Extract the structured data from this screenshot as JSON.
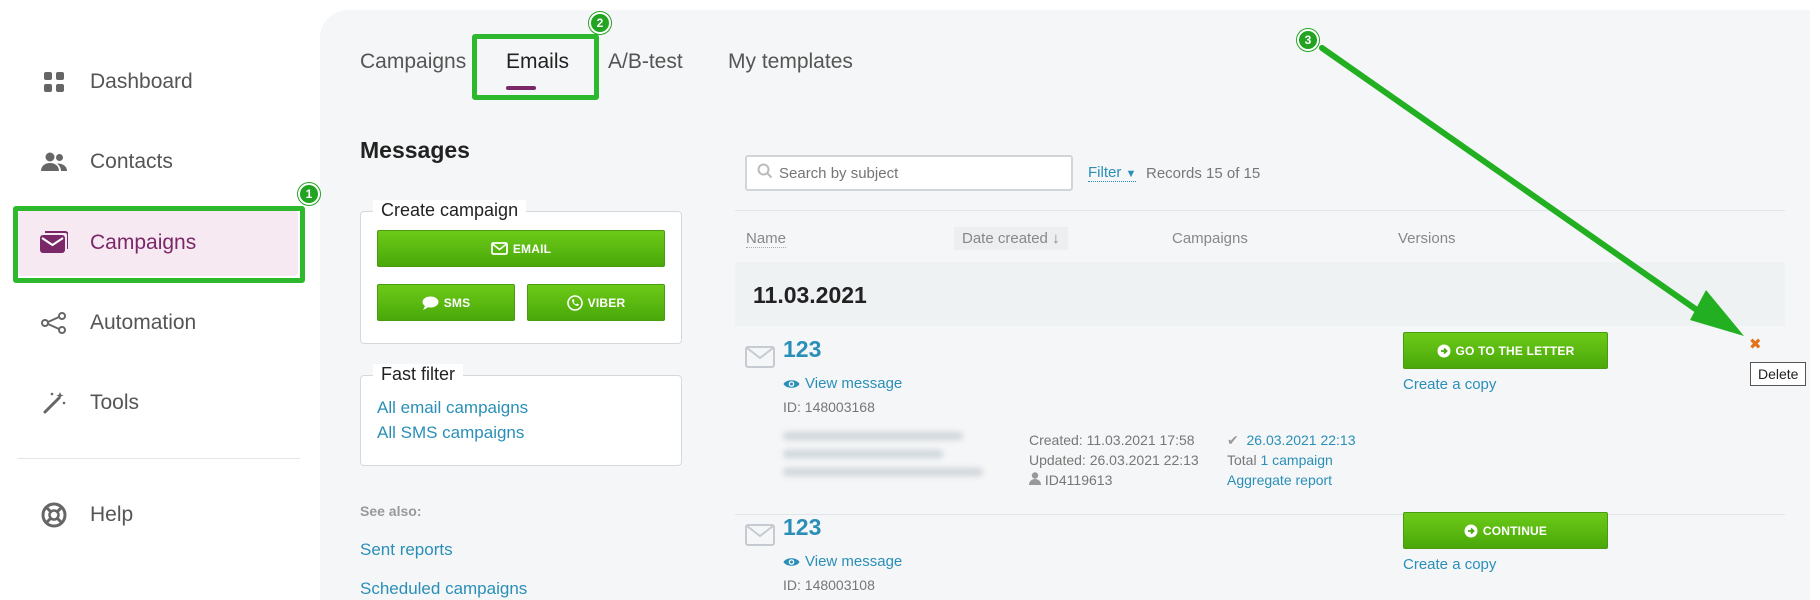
{
  "sidebar": {
    "items": [
      {
        "label": "Dashboard",
        "icon": "grid-icon"
      },
      {
        "label": "Contacts",
        "icon": "users-icon"
      },
      {
        "label": "Campaigns",
        "icon": "envelope-stack-icon"
      },
      {
        "label": "Automation",
        "icon": "share-nodes-icon"
      },
      {
        "label": "Tools",
        "icon": "magic-wand-icon"
      },
      {
        "label": "Help",
        "icon": "lifebuoy-icon"
      }
    ]
  },
  "annotations": {
    "badge_1": "1",
    "badge_2": "2",
    "badge_3": "3"
  },
  "tabs": [
    {
      "label": "Campaigns"
    },
    {
      "label": "Emails"
    },
    {
      "label": "A/B-test"
    },
    {
      "label": "My templates"
    }
  ],
  "left_panel": {
    "title": "Messages",
    "create_campaign": {
      "legend": "Create campaign",
      "email_label": "EMAIL",
      "sms_label": "SMS",
      "viber_label": "VIBER"
    },
    "fast_filter": {
      "legend": "Fast filter",
      "links": [
        "All email campaigns",
        "All SMS campaigns"
      ]
    },
    "see_also": {
      "heading": "See also:",
      "links": [
        "Sent reports",
        "Scheduled campaigns"
      ]
    }
  },
  "search": {
    "placeholder": "Search by subject"
  },
  "filter_label": "Filter",
  "records_text": "Records 15 of 15",
  "table": {
    "columns": [
      "Name",
      "Date created",
      "Campaigns",
      "Versions"
    ],
    "date_group": "11.03.2021",
    "rows": [
      {
        "name": "123",
        "view_label": "View message",
        "id_text": "ID: 148003168",
        "created": "Created: 11.03.2021 17:58",
        "updated": "Updated: 26.03.2021 22:13",
        "user_id": "ID4119613",
        "sent_date": "26.03.2021 22:13",
        "total_prefix": "Total",
        "total_link": "1 campaign",
        "report_link": "Aggregate report",
        "action_label": "GO TO THE LETTER",
        "copy_label": "Create a copy",
        "delete_symbol": "✖",
        "delete_tooltip": "Delete"
      },
      {
        "name": "123",
        "view_label": "View message",
        "id_text": "ID: 148003108",
        "action_label": "CONTINUE",
        "copy_label": "Create a copy"
      }
    ]
  },
  "colors": {
    "accent": "#7b2869",
    "link": "#2a8fb8",
    "green_button": "#58b410",
    "annotation_green": "#2eb82e",
    "delete": "#e2741e"
  }
}
